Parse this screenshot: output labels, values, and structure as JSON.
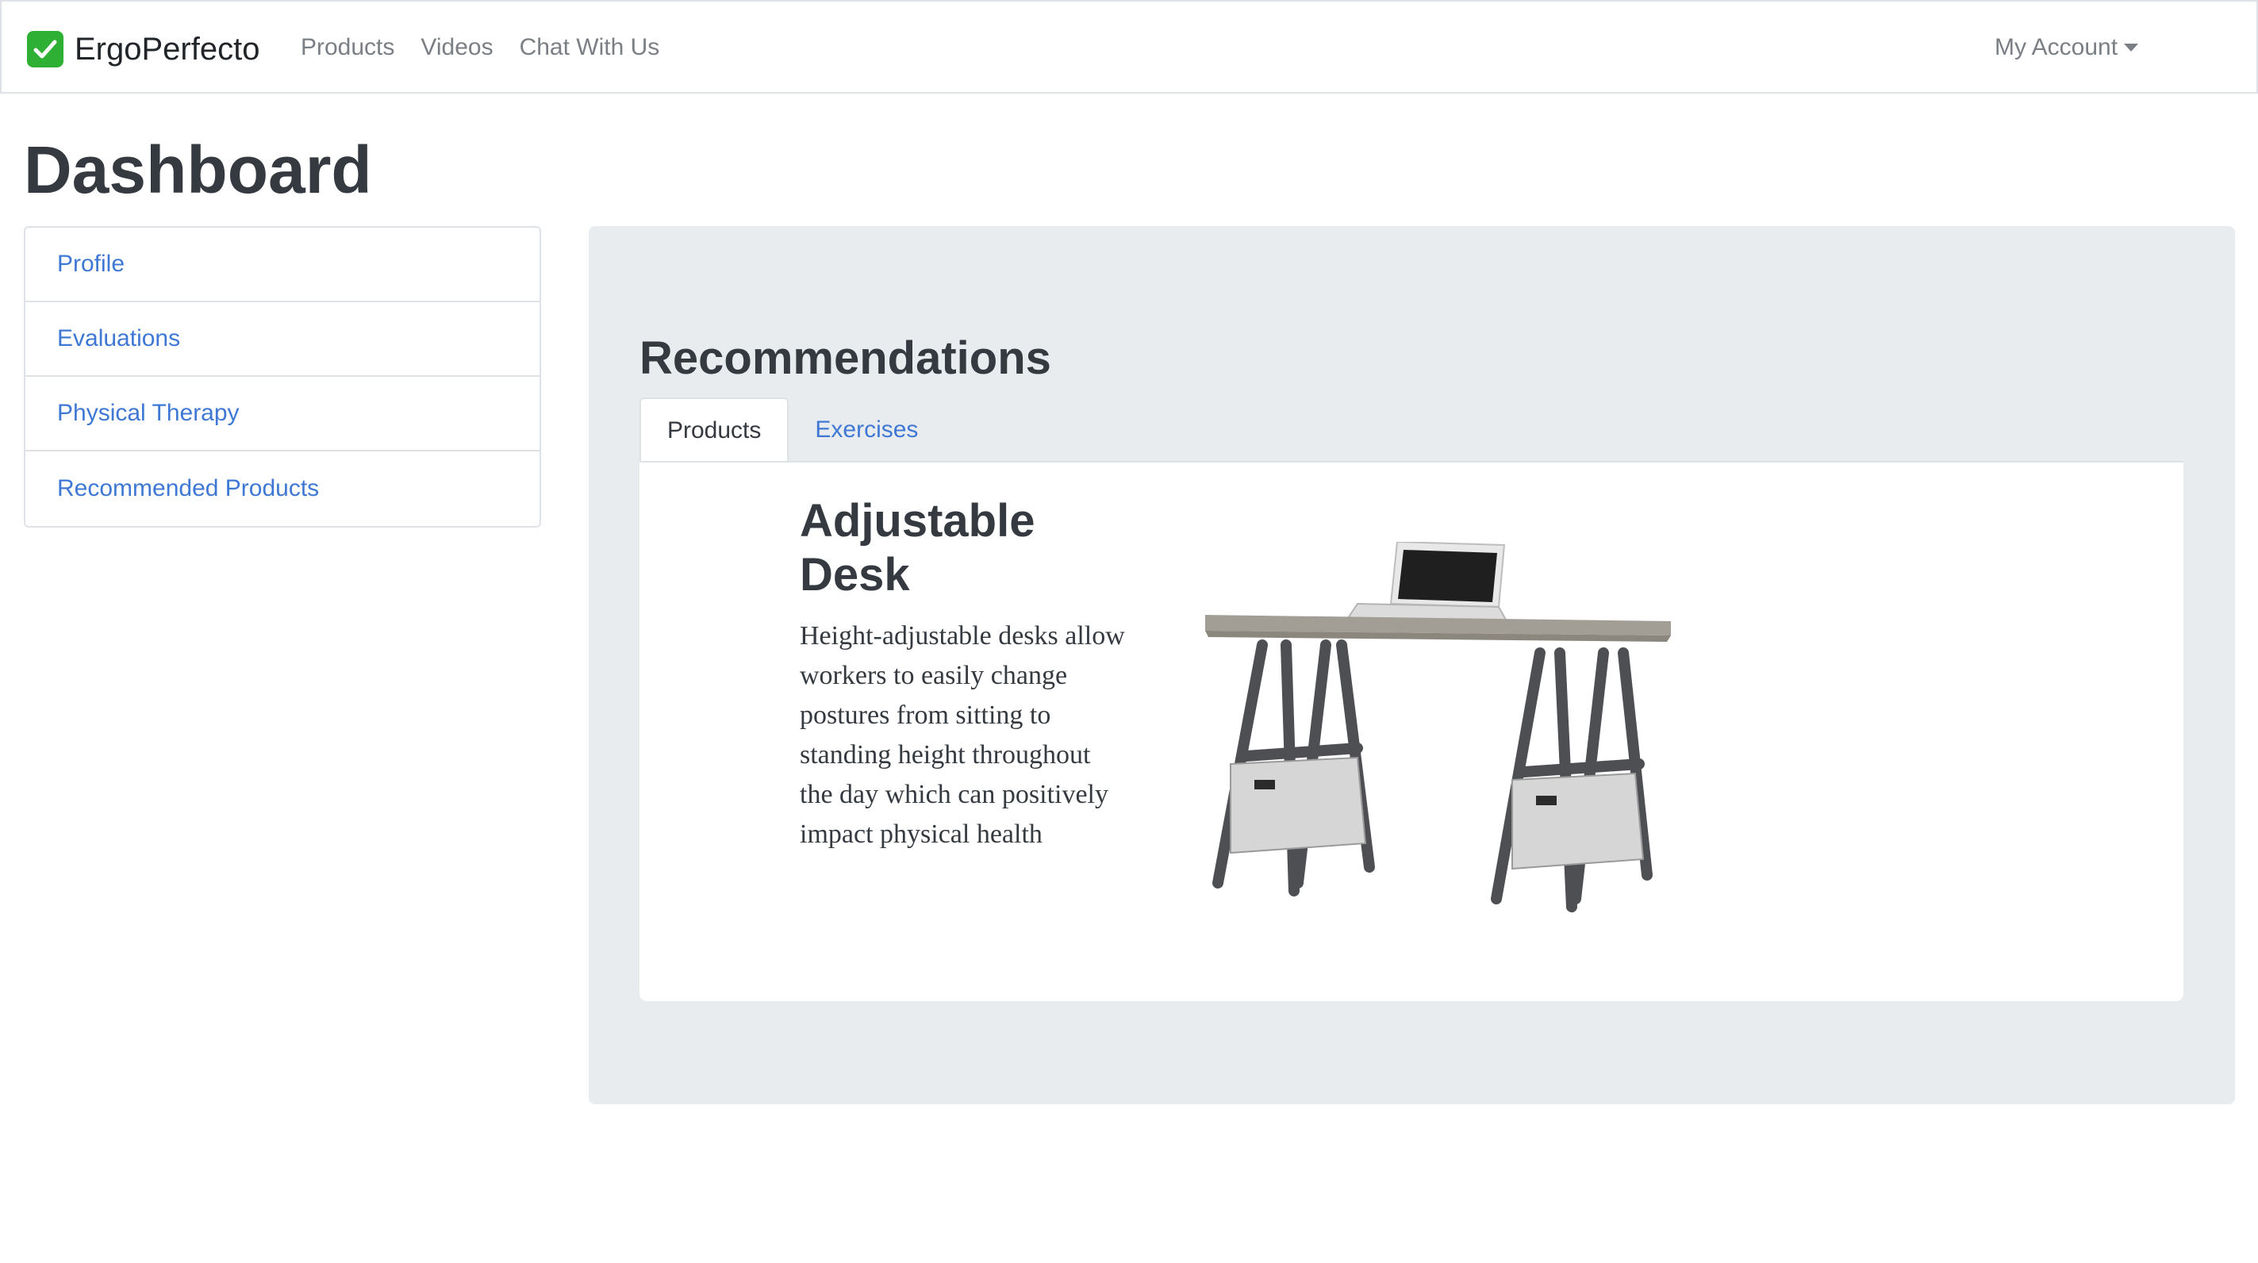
{
  "navbar": {
    "brand": "ErgoPerfecto",
    "links": [
      "Products",
      "Videos",
      "Chat With Us"
    ],
    "account": "My Account"
  },
  "page": {
    "title": "Dashboard"
  },
  "sidebar": {
    "items": [
      {
        "label": "Profile"
      },
      {
        "label": "Evaluations"
      },
      {
        "label": "Physical Therapy"
      },
      {
        "label": "Recommended Products"
      }
    ]
  },
  "recommendations": {
    "title": "Recommendations",
    "tabs": [
      {
        "label": "Products",
        "active": true
      },
      {
        "label": "Exercises",
        "active": false
      }
    ],
    "product": {
      "name": "Adjustable Desk",
      "description": "Height-adjustable desks allow workers to easily change postures from sitting to standing height throughout the day which can positively impact physical health"
    }
  },
  "colors": {
    "link": "#3f78d4",
    "brand_check": "#2eb034",
    "jumbotron": "#e9ecef",
    "heading": "#343a40"
  }
}
